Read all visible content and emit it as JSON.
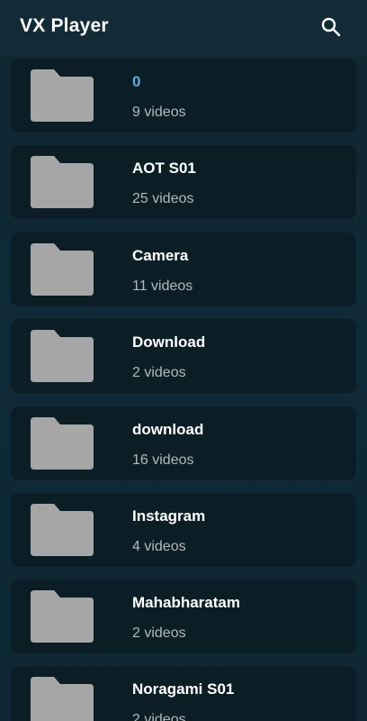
{
  "app": {
    "title": "VX Player",
    "search_icon": "search-icon"
  },
  "folders": [
    {
      "name": "0",
      "count": "9 videos",
      "highlighted": true
    },
    {
      "name": "AOT S01",
      "count": "25 videos"
    },
    {
      "name": "Camera",
      "count": "11 videos"
    },
    {
      "name": "Download",
      "count": "2 videos"
    },
    {
      "name": "download",
      "count": "16 videos"
    },
    {
      "name": "Instagram",
      "count": "4 videos"
    },
    {
      "name": "Mahabharatam",
      "count": "2 videos"
    },
    {
      "name": "Noragami S01",
      "count": "2 videos"
    }
  ],
  "colors": {
    "background": "#0f2530",
    "card": "#0c1e25",
    "folder_icon": "#a6a6a6",
    "highlight": "#5aaee0",
    "subtext": "#b3b9bd"
  }
}
